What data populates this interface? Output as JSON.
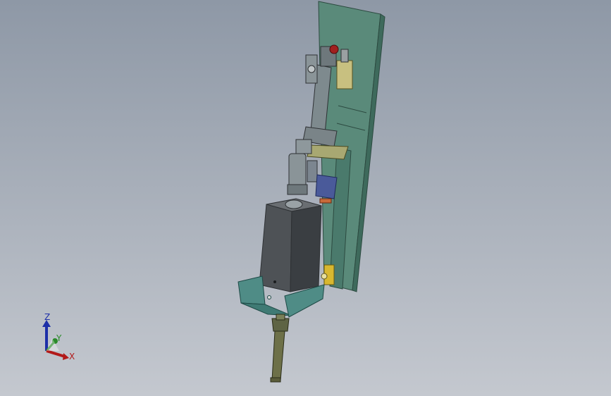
{
  "view": {
    "background_top": "#8e98a6",
    "background_bottom": "#c4c8cf"
  },
  "model": {
    "colors": {
      "mount_plate": "#5a8a7a",
      "mount_plate_dark": "#3e6a5c",
      "motor_body": "#4e5256",
      "motor_dark": "#2e3134",
      "bracket": "#4f8c86",
      "bracket_dark": "#2f6560",
      "cylinder": "#7e8a8e",
      "fitting_red": "#a0201f",
      "coupling": "#5e6444",
      "shaft": "#6d7048",
      "accent_blue": "#4a5a9a"
    }
  },
  "triad": {
    "z_label": "Z",
    "y_label": "Y",
    "x_label": "X",
    "z_color": "#1d2fa8",
    "y_color": "#2a8a2a",
    "x_color": "#b21a1a"
  }
}
